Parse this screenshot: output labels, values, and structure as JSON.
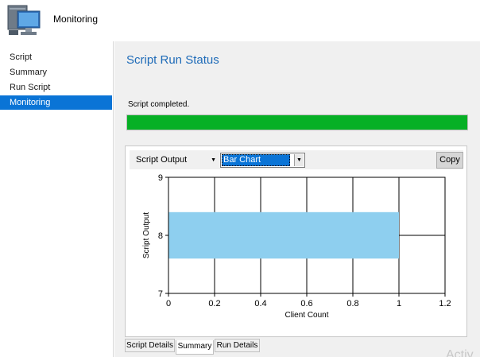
{
  "header": {
    "title": "Monitoring",
    "icon": "computer-monitor-icon"
  },
  "sidebar": {
    "items": [
      {
        "label": "Script",
        "active": false
      },
      {
        "label": "Summary",
        "active": false
      },
      {
        "label": "Run Script",
        "active": false
      },
      {
        "label": "Monitoring",
        "active": true
      }
    ]
  },
  "main": {
    "title": "Script Run Status",
    "status_text": "Script completed.",
    "progress": {
      "value": 1.0,
      "color": "#06b025"
    }
  },
  "toolbar": {
    "output_select": "Script Output",
    "chart_type_select": "Bar Chart",
    "copy_label": "Copy"
  },
  "chart_data": {
    "type": "bar",
    "orientation": "horizontal",
    "categories": [
      "8"
    ],
    "values": [
      1
    ],
    "xlabel": "Client Count",
    "ylabel": "Script Output",
    "xlim": [
      0,
      1.2
    ],
    "ylim": [
      7,
      9
    ],
    "xticks": [
      "0",
      "0.2",
      "0.4",
      "0.6",
      "0.8",
      "1",
      "1.2"
    ],
    "yticks": [
      "7",
      "8",
      "9"
    ],
    "grid": true,
    "bar_color": "#8ecfef"
  },
  "tabs": [
    {
      "label": "Script Details",
      "active": false
    },
    {
      "label": "Summary",
      "active": true
    },
    {
      "label": "Run Details",
      "active": false
    }
  ],
  "watermark": "Activ"
}
